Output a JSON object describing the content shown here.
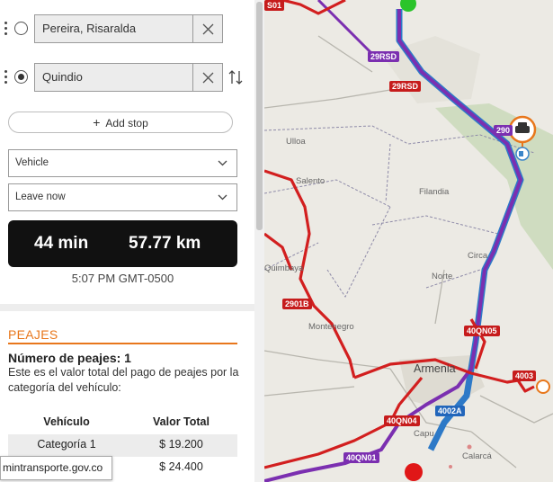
{
  "stops": [
    {
      "value": "Pereira, Risaralda"
    },
    {
      "value": "Quindio"
    }
  ],
  "add_stop_label": "Add stop",
  "vehicle_select": "Vehicle",
  "departure_select": "Leave now",
  "summary": {
    "time": "44 min",
    "distance": "57.77 km"
  },
  "arrival_time": "5:07 PM GMT-0500",
  "peajes": {
    "title": "PEAJES",
    "count_label": "Número de peajes: 1",
    "description": "Este es el valor total del pago de peajes por la categoría del vehículo:",
    "table": {
      "headers": [
        "Vehículo",
        "Valor Total"
      ],
      "rows": [
        [
          "Categoría 1",
          "$ 19.200"
        ],
        [
          "",
          "$ 24.400"
        ]
      ]
    }
  },
  "tooltip": "mintransporte.gov.co",
  "map": {
    "place_labels": [
      "Ulloa",
      "Filandia",
      "Circa",
      "Norte",
      "Montenegro",
      "Armenia",
      "Quimbaya",
      "Calarcá",
      "Salento",
      "Capu"
    ],
    "highway_shields": [
      "29RSD",
      "29RSD",
      "2901B",
      "40QN05",
      "4003",
      "40QN04",
      "4002A",
      "40QN01",
      "290",
      "S01"
    ]
  },
  "colors": {
    "accent": "#e8771c",
    "route_primary": "#7b2fb0",
    "route_alt": "#d21f1f",
    "summary_bg": "#111111"
  }
}
